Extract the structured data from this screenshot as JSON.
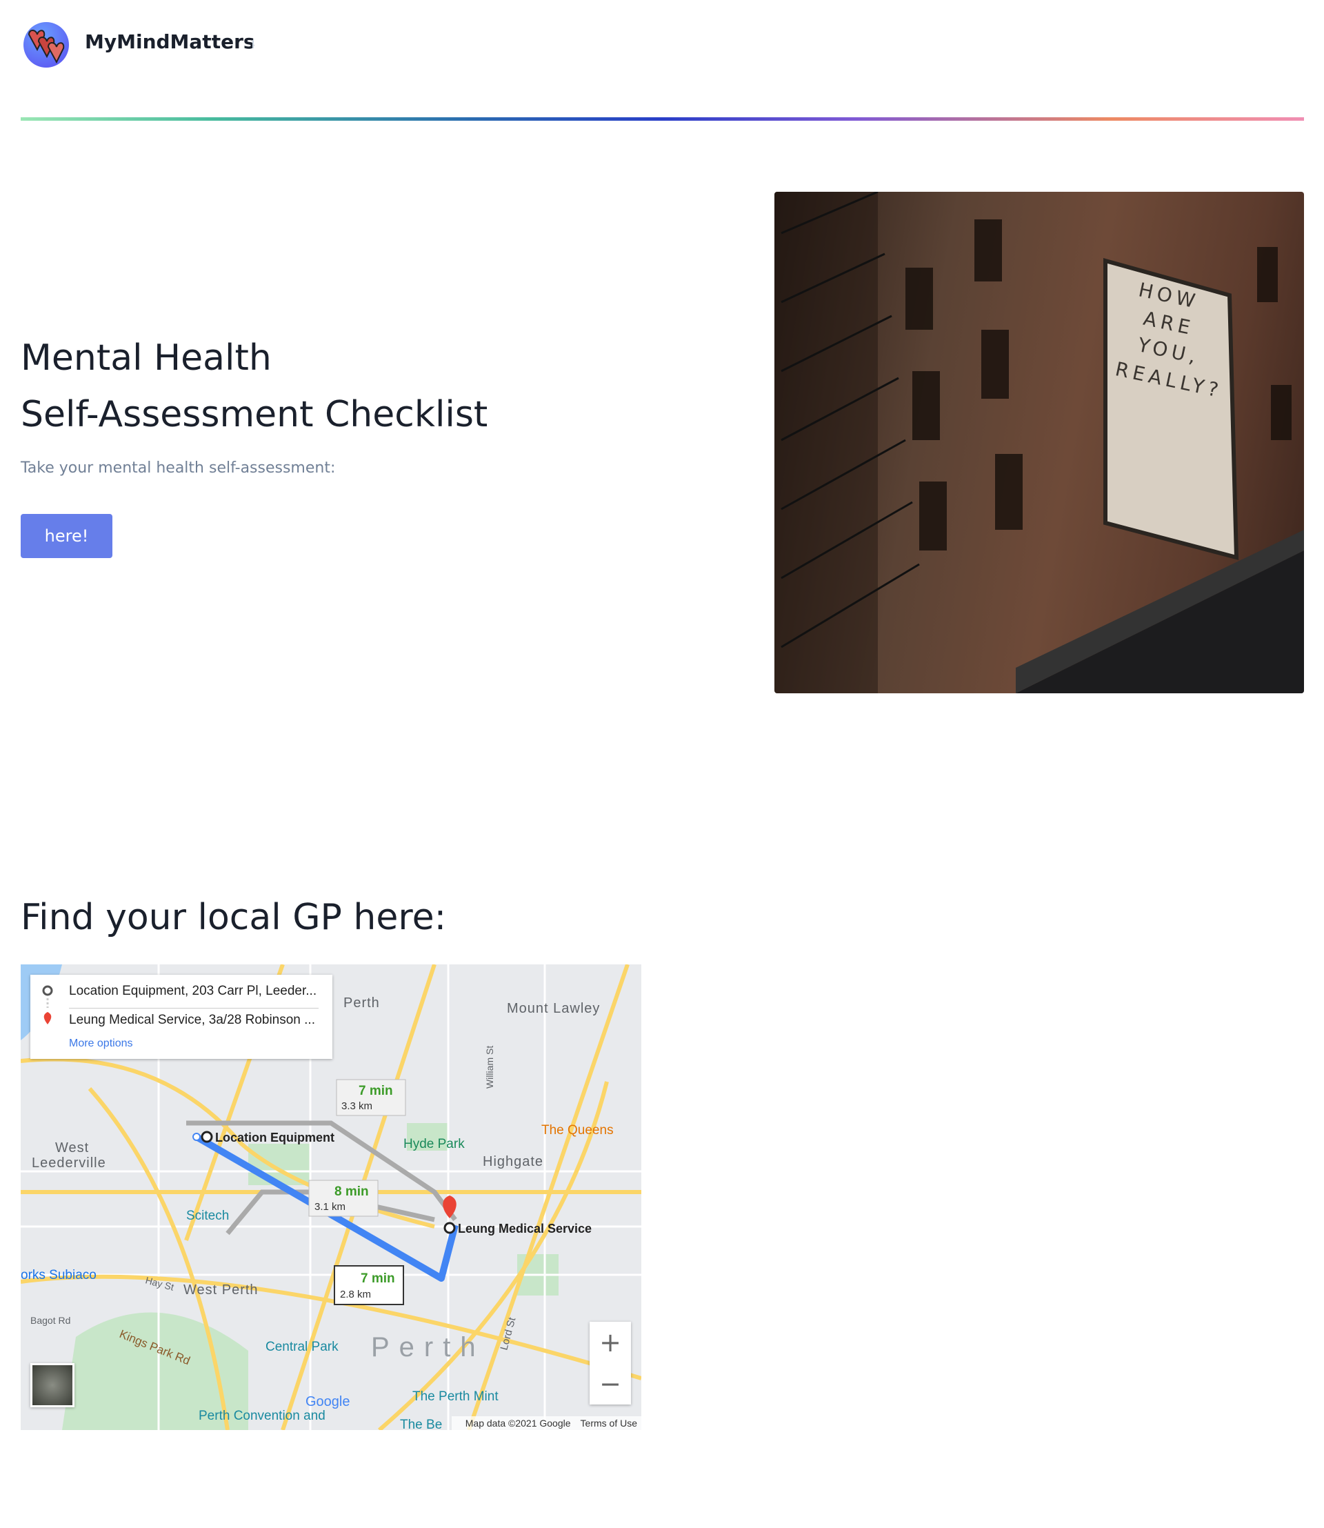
{
  "header": {
    "brand": "MyMindMatters",
    "logo_icon": "hearts-logo-icon"
  },
  "hero": {
    "title_line1": "Mental Health",
    "title_line2": "Self-Assessment Checklist",
    "subtitle": "Take your mental health self-assessment:",
    "button_label": "here!",
    "button_color": "#667eea",
    "photo_sign": [
      "HOW",
      "ARE",
      "YOU,",
      "REALLY?"
    ]
  },
  "gp": {
    "title": "Find your local GP here:",
    "map": {
      "origin": "Location Equipment, 203 Carr Pl, Leeder...",
      "destination": "Leung Medical Service, 3a/28 Robinson ...",
      "more_options": "More options",
      "routes": [
        {
          "time": "7 min",
          "distance": "3.3 km"
        },
        {
          "time": "8 min",
          "distance": "3.1 km"
        },
        {
          "time": "7 min",
          "distance": "2.8 km"
        }
      ],
      "labels": {
        "origin_pin": "Location Equipment",
        "dest_pin": "Leung Medical Service",
        "mount_lawley": "Mount Lawley",
        "north_perth": "Perth",
        "west_leederville": "West",
        "west_leederville2": "Leederville",
        "hyde_park": "Hyde Park",
        "highgate": "Highgate",
        "the_queens": "The Queens",
        "scitech": "Scitech",
        "subiaco": "orks Subiaco",
        "west_perth": "West Perth",
        "hay_st": "Hay St",
        "bagot_rd": "Bagot Rd",
        "kings_park_rd": "Kings Park Rd",
        "central_park": "Central Park",
        "perth": "Perth",
        "lord_st": "Lord St",
        "william_st": "William St",
        "perth_mint": "The Perth Mint",
        "convention": "Perth Convention and",
        "the_be": "The Be",
        "google": "Google"
      },
      "zoom_in": "+",
      "zoom_out": "−",
      "attribution": "Map data ©2021 Google",
      "terms": "Terms of Use"
    }
  }
}
